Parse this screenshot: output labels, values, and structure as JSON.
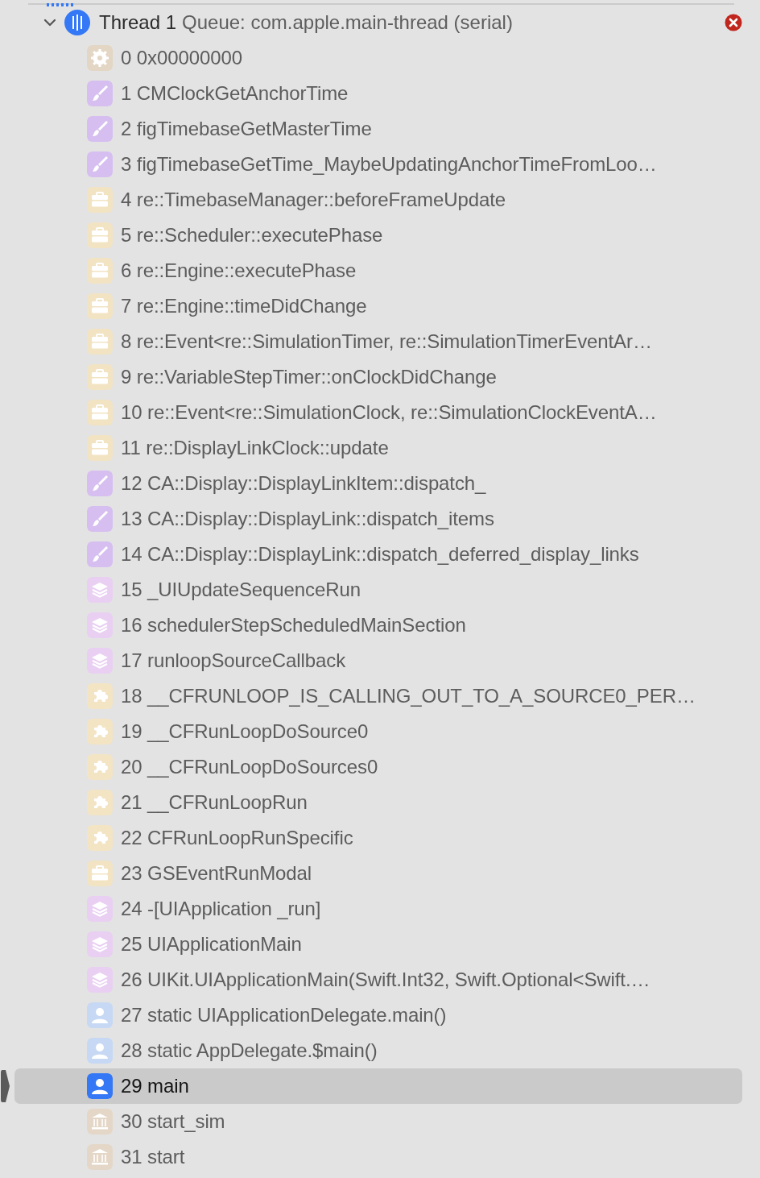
{
  "thread": {
    "expanded": true,
    "name": "Thread 1",
    "queue": "Queue: com.apple.main-thread (serial)",
    "error": true
  },
  "frames": [
    {
      "text": "0 0x00000000",
      "kind": "gear",
      "selected": false
    },
    {
      "text": "1 CMClockGetAnchorTime",
      "kind": "brush",
      "selected": false
    },
    {
      "text": "2 figTimebaseGetMasterTime",
      "kind": "brush",
      "selected": false
    },
    {
      "text": "3 figTimebaseGetTime_MaybeUpdatingAnchorTimeFromLoo…",
      "kind": "brush",
      "selected": false
    },
    {
      "text": "4 re::TimebaseManager::beforeFrameUpdate",
      "kind": "toolbox",
      "selected": false
    },
    {
      "text": "5 re::Scheduler::executePhase",
      "kind": "toolbox",
      "selected": false
    },
    {
      "text": "6 re::Engine::executePhase",
      "kind": "toolbox",
      "selected": false
    },
    {
      "text": "7 re::Engine::timeDidChange",
      "kind": "toolbox",
      "selected": false
    },
    {
      "text": "8 re::Event<re::SimulationTimer, re::SimulationTimerEventAr…",
      "kind": "toolbox",
      "selected": false
    },
    {
      "text": "9 re::VariableStepTimer::onClockDidChange",
      "kind": "toolbox",
      "selected": false
    },
    {
      "text": "10 re::Event<re::SimulationClock, re::SimulationClockEventA…",
      "kind": "toolbox",
      "selected": false
    },
    {
      "text": "11 re::DisplayLinkClock::update",
      "kind": "toolbox",
      "selected": false
    },
    {
      "text": "12 CA::Display::DisplayLinkItem::dispatch_",
      "kind": "brush",
      "selected": false
    },
    {
      "text": "13 CA::Display::DisplayLink::dispatch_items",
      "kind": "brush",
      "selected": false
    },
    {
      "text": "14 CA::Display::DisplayLink::dispatch_deferred_display_links",
      "kind": "brush",
      "selected": false
    },
    {
      "text": "15 _UIUpdateSequenceRun",
      "kind": "layers",
      "selected": false
    },
    {
      "text": "16 schedulerStepScheduledMainSection",
      "kind": "layers",
      "selected": false
    },
    {
      "text": "17 runloopSourceCallback",
      "kind": "layers",
      "selected": false
    },
    {
      "text": "18 __CFRUNLOOP_IS_CALLING_OUT_TO_A_SOURCE0_PER…",
      "kind": "puzzle",
      "selected": false
    },
    {
      "text": "19 __CFRunLoopDoSource0",
      "kind": "puzzle",
      "selected": false
    },
    {
      "text": "20 __CFRunLoopDoSources0",
      "kind": "puzzle",
      "selected": false
    },
    {
      "text": "21 __CFRunLoopRun",
      "kind": "puzzle",
      "selected": false
    },
    {
      "text": "22 CFRunLoopRunSpecific",
      "kind": "puzzle",
      "selected": false
    },
    {
      "text": "23 GSEventRunModal",
      "kind": "toolbox",
      "selected": false
    },
    {
      "text": "24 -[UIApplication _run]",
      "kind": "layers",
      "selected": false
    },
    {
      "text": "25 UIApplicationMain",
      "kind": "layers",
      "selected": false
    },
    {
      "text": "26 UIKit.UIApplicationMain(Swift.Int32, Swift.Optional<Swift.…",
      "kind": "layers",
      "selected": false
    },
    {
      "text": "27 static UIApplicationDelegate.main()",
      "kind": "person",
      "selected": false
    },
    {
      "text": "28 static AppDelegate.$main()",
      "kind": "person",
      "selected": false
    },
    {
      "text": "29 main",
      "kind": "person",
      "selected": true
    },
    {
      "text": "30 start_sim",
      "kind": "bank",
      "selected": false
    },
    {
      "text": "31 start",
      "kind": "bank",
      "selected": false
    }
  ]
}
